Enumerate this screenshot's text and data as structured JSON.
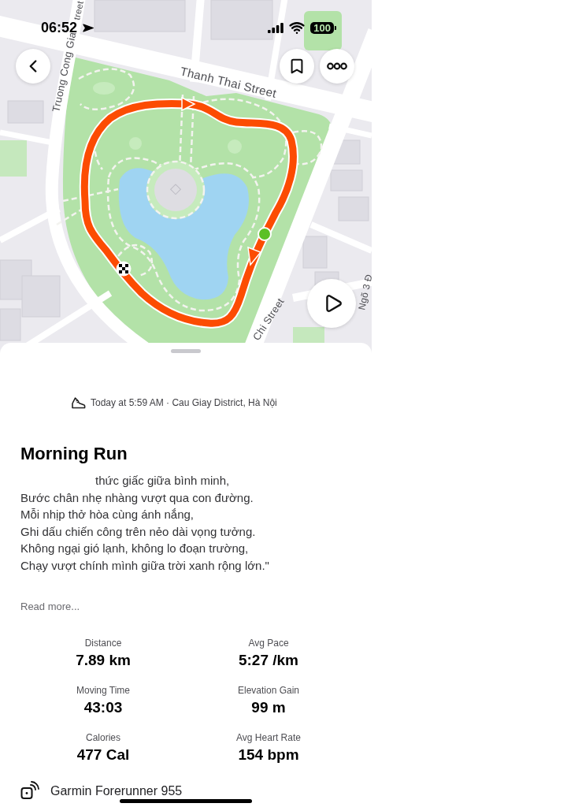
{
  "status_bar": {
    "time": "06:52",
    "battery": "100"
  },
  "map": {
    "street_labels": [
      {
        "text": "Thanh Thai Street"
      },
      {
        "text": "Truong Cong Gia"
      },
      {
        "text": "treet"
      },
      {
        "text": "Chi Street"
      },
      {
        "text": "Ngõ 3 Đ"
      }
    ]
  },
  "activity": {
    "meta": "Today at 5:59 AM · Cau Giay District, Hà Nội",
    "title": "Morning Run",
    "description": "thức giấc giữa bình minh,\nBước chân nhẹ nhàng vượt qua con đường.\nMỗi nhịp thở hòa cùng ánh nắng,\nGhi dấu chiến công trên nẻo dài vọng tưởng.\nKhông ngại gió lạnh, không lo đoạn trường,\nChạy vượt chính mình giữa trời xanh rộng lớn.\"",
    "read_more": "Read more..."
  },
  "stats": [
    {
      "label": "Distance",
      "value": "7.89 km"
    },
    {
      "label": "Avg Pace",
      "value": "5:27 /km"
    },
    {
      "label": "Moving Time",
      "value": "43:03"
    },
    {
      "label": "Elevation Gain",
      "value": "99 m"
    },
    {
      "label": "Calories",
      "value": "477 Cal"
    },
    {
      "label": "Avg Heart Rate",
      "value": "154 bpm"
    }
  ],
  "device": {
    "name": "Garmin Forerunner 955"
  }
}
